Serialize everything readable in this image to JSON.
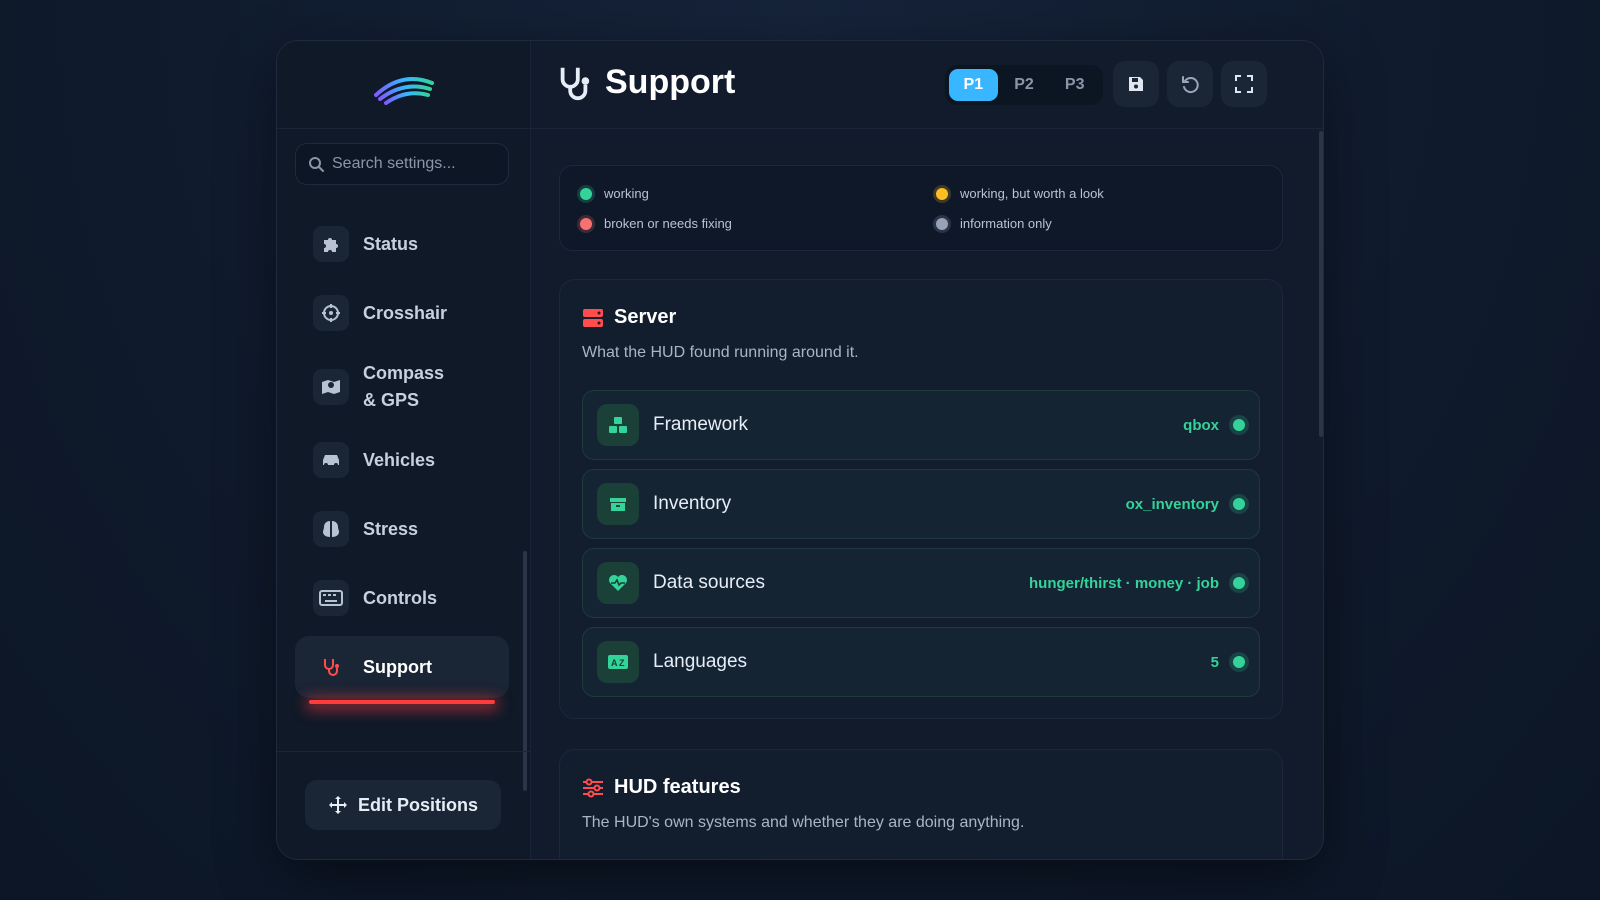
{
  "search": {
    "placeholder": "Search settings..."
  },
  "sidebar": {
    "items": [
      {
        "label": "Status",
        "icon": "puzzle-icon"
      },
      {
        "label": "Crosshair",
        "icon": "crosshair-icon"
      },
      {
        "label": "Compass\n& GPS",
        "icon": "map-pin-icon"
      },
      {
        "label": "Vehicles",
        "icon": "car-icon"
      },
      {
        "label": "Stress",
        "icon": "brain-icon"
      },
      {
        "label": "Controls",
        "icon": "keyboard-icon"
      },
      {
        "label": "Support",
        "icon": "stethoscope-icon",
        "active": true
      }
    ],
    "edit_label": "Edit Positions"
  },
  "header": {
    "title": "Support",
    "presets": [
      "P1",
      "P2",
      "P3"
    ],
    "active_preset": "P1"
  },
  "legend": {
    "items": [
      {
        "label": "working",
        "color": "#34d399"
      },
      {
        "label": "working, but worth a look",
        "color": "#fbbf24"
      },
      {
        "label": "broken or needs fixing",
        "color": "#f87171"
      },
      {
        "label": "information only",
        "color": "#94a3b8"
      }
    ]
  },
  "server": {
    "title": "Server",
    "subtitle": "What the HUD found running around it.",
    "rows": [
      {
        "name": "Framework",
        "value": "qbox",
        "icon": "cubes-icon"
      },
      {
        "name": "Inventory",
        "value": "ox_inventory",
        "icon": "box-icon"
      },
      {
        "name": "Data sources",
        "value": "hunger/thirst · money · job",
        "icon": "heart-pulse-icon"
      },
      {
        "name": "Languages",
        "value": "5",
        "icon": "language-icon"
      }
    ]
  },
  "features": {
    "title": "HUD features",
    "subtitle": "The HUD's own systems and whether they are doing anything."
  },
  "colors": {
    "accent": "#38b6ff",
    "danger": "#ff3b3b",
    "ok": "#34d399"
  }
}
